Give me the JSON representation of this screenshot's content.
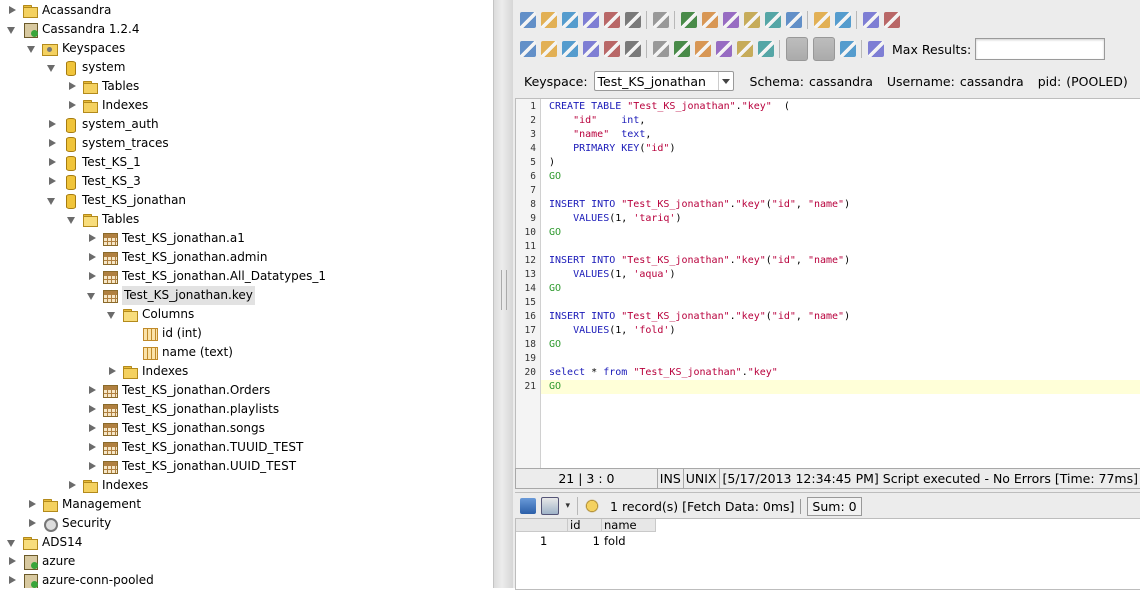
{
  "tree": [
    {
      "depth": 0,
      "tw": "right",
      "icon": "folder",
      "label": "Acassandra"
    },
    {
      "depth": 0,
      "tw": "down",
      "icon": "server",
      "label": "Cassandra 1.2.4"
    },
    {
      "depth": 1,
      "tw": "down",
      "icon": "keysp",
      "label": "Keyspaces"
    },
    {
      "depth": 2,
      "tw": "down",
      "icon": "db",
      "label": "system"
    },
    {
      "depth": 3,
      "tw": "right",
      "icon": "folder",
      "label": "Tables"
    },
    {
      "depth": 3,
      "tw": "right",
      "icon": "folder",
      "label": "Indexes"
    },
    {
      "depth": 2,
      "tw": "right",
      "icon": "db",
      "label": "system_auth"
    },
    {
      "depth": 2,
      "tw": "right",
      "icon": "db",
      "label": "system_traces"
    },
    {
      "depth": 2,
      "tw": "right",
      "icon": "db",
      "label": "Test_KS_1"
    },
    {
      "depth": 2,
      "tw": "right",
      "icon": "db",
      "label": "Test_KS_3"
    },
    {
      "depth": 2,
      "tw": "down",
      "icon": "db",
      "label": "Test_KS_jonathan"
    },
    {
      "depth": 3,
      "tw": "down",
      "icon": "folder open",
      "label": "Tables"
    },
    {
      "depth": 4,
      "tw": "right",
      "icon": "table",
      "label": "Test_KS_jonathan.a1"
    },
    {
      "depth": 4,
      "tw": "right",
      "icon": "table",
      "label": "Test_KS_jonathan.admin"
    },
    {
      "depth": 4,
      "tw": "right",
      "icon": "table",
      "label": "Test_KS_jonathan.All_Datatypes_1"
    },
    {
      "depth": 4,
      "tw": "down",
      "icon": "table",
      "label": "Test_KS_jonathan.key",
      "selected": true
    },
    {
      "depth": 5,
      "tw": "down",
      "icon": "folder open",
      "label": "Columns"
    },
    {
      "depth": 6,
      "tw": "none",
      "icon": "col",
      "label": "id (int)"
    },
    {
      "depth": 6,
      "tw": "none",
      "icon": "col",
      "label": "name (text)"
    },
    {
      "depth": 5,
      "tw": "right",
      "icon": "folder",
      "label": "Indexes"
    },
    {
      "depth": 4,
      "tw": "right",
      "icon": "table",
      "label": "Test_KS_jonathan.Orders"
    },
    {
      "depth": 4,
      "tw": "right",
      "icon": "table",
      "label": "Test_KS_jonathan.playlists"
    },
    {
      "depth": 4,
      "tw": "right",
      "icon": "table",
      "label": "Test_KS_jonathan.songs"
    },
    {
      "depth": 4,
      "tw": "right",
      "icon": "table",
      "label": "Test_KS_jonathan.TUUID_TEST"
    },
    {
      "depth": 4,
      "tw": "right",
      "icon": "table",
      "label": "Test_KS_jonathan.UUID_TEST"
    },
    {
      "depth": 3,
      "tw": "right",
      "icon": "folder",
      "label": "Indexes"
    },
    {
      "depth": 1,
      "tw": "right",
      "icon": "folder",
      "label": "Management"
    },
    {
      "depth": 1,
      "tw": "right",
      "icon": "gear",
      "label": "Security"
    },
    {
      "depth": 0,
      "tw": "down",
      "icon": "folder open",
      "label": "ADS14"
    },
    {
      "depth": 0,
      "tw": "right",
      "icon": "server",
      "label": "azure"
    },
    {
      "depth": 0,
      "tw": "right",
      "icon": "server",
      "label": "azure-conn-pooled"
    }
  ],
  "toolbar": {
    "max_results_label": "Max Results:",
    "max_results_value": "",
    "row1_icons": [
      "new-query-icon",
      "open-icon",
      "save-icon",
      "save-all-icon",
      "save-as-icon",
      "print-icon",
      "sep",
      "page-setup-icon",
      "sep",
      "select-icon",
      "cut-icon",
      "copy-icon",
      "paste-icon",
      "undo-icon",
      "redo-icon",
      "sep",
      "format-sql-icon",
      "find-icon",
      "sep",
      "uppercase-icon",
      "lowercase-icon"
    ],
    "row2_icons": [
      "execute-all-icon",
      "execute-icon",
      "execute-current-icon",
      "explain-icon",
      "execute-to-file-icon",
      "stop-icon",
      "sep",
      "commit-icon",
      "rollback-icon",
      "tx-begin-icon",
      "tx-end-icon",
      "auto-commit-icon",
      "isolation-icon",
      "sep",
      "results-grid-icon",
      "results-text-icon",
      "load-results-icon",
      "sep",
      "history-icon"
    ],
    "row2_pressed": [
      "results-grid-icon",
      "results-text-icon"
    ]
  },
  "session": {
    "keyspace_label": "Keyspace:",
    "keyspace_value": "Test_KS_jonathan",
    "schema_label": "Schema:",
    "schema_value": "cassandra",
    "username_label": "Username:",
    "username_value": "cassandra",
    "pid_label": "pid:",
    "pid_value": "(POOLED)"
  },
  "editor": {
    "current_line": 21,
    "lines": [
      [
        [
          "kw",
          "CREATE TABLE "
        ],
        [
          "str",
          "\"Test_KS_jonathan\""
        ],
        [
          "plain",
          "."
        ],
        [
          "str",
          "\"key\""
        ],
        [
          "plain",
          "  ("
        ]
      ],
      [
        [
          "plain",
          "    "
        ],
        [
          "str",
          "\"id\""
        ],
        [
          "plain",
          "    "
        ],
        [
          "kw",
          "int"
        ],
        [
          "plain",
          ","
        ]
      ],
      [
        [
          "plain",
          "    "
        ],
        [
          "str",
          "\"name\""
        ],
        [
          "plain",
          "  "
        ],
        [
          "kw",
          "text"
        ],
        [
          "plain",
          ","
        ]
      ],
      [
        [
          "plain",
          "    "
        ],
        [
          "kw",
          "PRIMARY KEY"
        ],
        [
          "plain",
          "("
        ],
        [
          "str",
          "\"id\""
        ],
        [
          "plain",
          ")"
        ]
      ],
      [
        [
          "plain",
          ")"
        ]
      ],
      [
        [
          "go",
          "GO"
        ]
      ],
      [],
      [
        [
          "kw",
          "INSERT INTO "
        ],
        [
          "str",
          "\"Test_KS_jonathan\""
        ],
        [
          "plain",
          "."
        ],
        [
          "str",
          "\"key\""
        ],
        [
          "plain",
          "("
        ],
        [
          "str",
          "\"id\""
        ],
        [
          "plain",
          ", "
        ],
        [
          "str",
          "\"name\""
        ],
        [
          "plain",
          ")"
        ]
      ],
      [
        [
          "plain",
          "    "
        ],
        [
          "kw",
          "VALUES"
        ],
        [
          "plain",
          "(1, "
        ],
        [
          "str",
          "'tariq'"
        ],
        [
          "plain",
          ")"
        ]
      ],
      [
        [
          "go",
          "GO"
        ]
      ],
      [],
      [
        [
          "kw",
          "INSERT INTO "
        ],
        [
          "str",
          "\"Test_KS_jonathan\""
        ],
        [
          "plain",
          "."
        ],
        [
          "str",
          "\"key\""
        ],
        [
          "plain",
          "("
        ],
        [
          "str",
          "\"id\""
        ],
        [
          "plain",
          ", "
        ],
        [
          "str",
          "\"name\""
        ],
        [
          "plain",
          ")"
        ]
      ],
      [
        [
          "plain",
          "    "
        ],
        [
          "kw",
          "VALUES"
        ],
        [
          "plain",
          "(1, "
        ],
        [
          "str",
          "'aqua'"
        ],
        [
          "plain",
          ")"
        ]
      ],
      [
        [
          "go",
          "GO"
        ]
      ],
      [],
      [
        [
          "kw",
          "INSERT INTO "
        ],
        [
          "str",
          "\"Test_KS_jonathan\""
        ],
        [
          "plain",
          "."
        ],
        [
          "str",
          "\"key\""
        ],
        [
          "plain",
          "("
        ],
        [
          "str",
          "\"id\""
        ],
        [
          "plain",
          ", "
        ],
        [
          "str",
          "\"name\""
        ],
        [
          "plain",
          ")"
        ]
      ],
      [
        [
          "plain",
          "    "
        ],
        [
          "kw",
          "VALUES"
        ],
        [
          "plain",
          "(1, "
        ],
        [
          "str",
          "'fold'"
        ],
        [
          "plain",
          ")"
        ]
      ],
      [
        [
          "go",
          "GO"
        ]
      ],
      [],
      [
        [
          "kw",
          "select"
        ],
        [
          "plain",
          " * "
        ],
        [
          "kw",
          "from"
        ],
        [
          "plain",
          " "
        ],
        [
          "str",
          "\"Test_KS_jonathan\""
        ],
        [
          "plain",
          "."
        ],
        [
          "str",
          "\"key\""
        ]
      ],
      [
        [
          "go",
          "GO"
        ]
      ]
    ]
  },
  "status": {
    "position": "21 | 3 : 0",
    "ins": "INS",
    "eol": "UNIX",
    "message": "[5/17/2013 12:34:45 PM] Script executed - No Errors [Time: 77ms]"
  },
  "results": {
    "records": "1 record(s) [Fetch Data: 0ms]",
    "sum": "Sum: 0",
    "columns": [
      "id",
      "name"
    ],
    "rows": [
      [
        "1",
        "1",
        "fold"
      ]
    ]
  },
  "colors": {
    "keyword": "#1a1ab8",
    "string": "#b8003c",
    "go": "#2e9a2e",
    "current_line": "#ffffd8"
  }
}
